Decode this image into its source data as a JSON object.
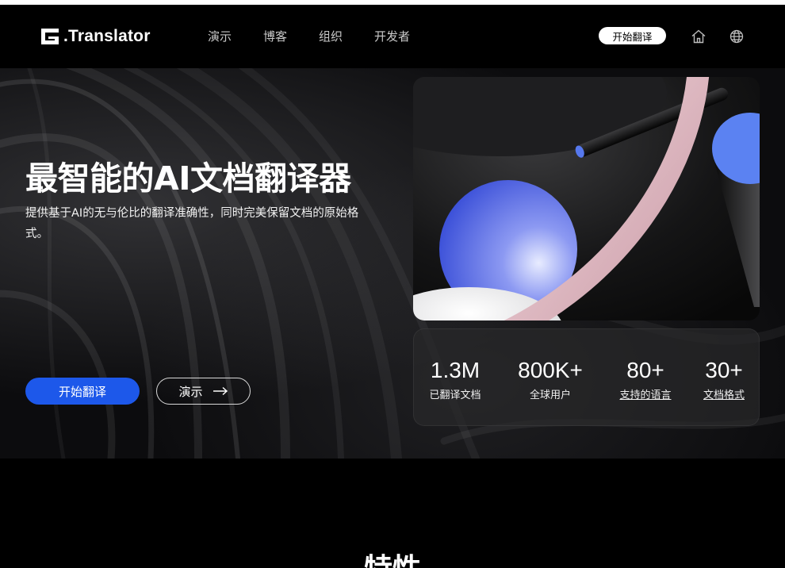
{
  "header": {
    "logo_text": ".Translator",
    "nav": [
      "演示",
      "博客",
      "组织",
      "开发者"
    ],
    "cta_label": "开始翻译",
    "icons": [
      "home-icon",
      "globe-icon"
    ]
  },
  "hero": {
    "title": "最智能的AI文档翻译器",
    "subtitle": "提供基于AI的无与伦比的翻译准确性，同时完美保留文档的原始格式。",
    "primary_button": "开始翻译",
    "secondary_button": "演示",
    "secondary_icon": "arrow-right-icon"
  },
  "stats": [
    {
      "value": "1.3M",
      "label": "已翻译文档"
    },
    {
      "value": "800K+",
      "label": "全球用户"
    },
    {
      "value": "80+",
      "label": "支持的语言"
    },
    {
      "value": "30+",
      "label": "文档格式"
    }
  ],
  "features": {
    "title": "特性"
  },
  "colors": {
    "accent": "#1d58ea",
    "background": "#000000"
  }
}
